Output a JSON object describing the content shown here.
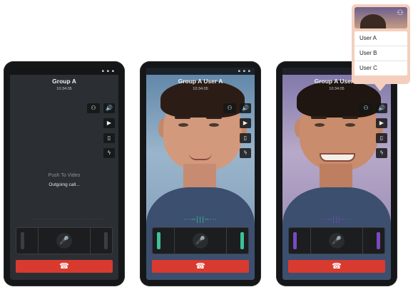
{
  "phones": [
    {
      "title": "Group A",
      "time": "10:34:05",
      "status_icons": "▪ ▪ ▪",
      "label": "Push To Video",
      "status": "Outgoing call...",
      "voice_wave": "··························",
      "icons": {
        "users": "⚇",
        "speaker": "🔊",
        "camera": "▶",
        "device": "▯",
        "flash": "ϟ",
        "mic": "🎤",
        "end_call": "☎"
      },
      "accent": "#4a4e52"
    },
    {
      "title": "Group A User A",
      "time": "10:34:05",
      "status_icons": "▪ ▪ ▪",
      "voice_wave": "···─|||─···",
      "icons": {
        "users": "⚇",
        "speaker": "🔊",
        "camera": "▶",
        "device": "▯",
        "flash": "ϟ",
        "mic": "🎤",
        "end_call": "☎"
      },
      "accent": "#3fbf9a"
    },
    {
      "title": "Group A User A",
      "time": "10:34:05",
      "status_icons": "▪ ▪ ▪",
      "voice_wave": "···─|||─···",
      "icons": {
        "users": "⚇",
        "speaker": "🔊",
        "camera": "▶",
        "device": "▯",
        "flash": "ϟ",
        "mic": "🎤",
        "end_call": "☎"
      },
      "accent": "#7a4ac0"
    }
  ],
  "popup": {
    "users_icon": "⚇",
    "items": [
      "User A",
      "User B",
      "User C"
    ]
  }
}
